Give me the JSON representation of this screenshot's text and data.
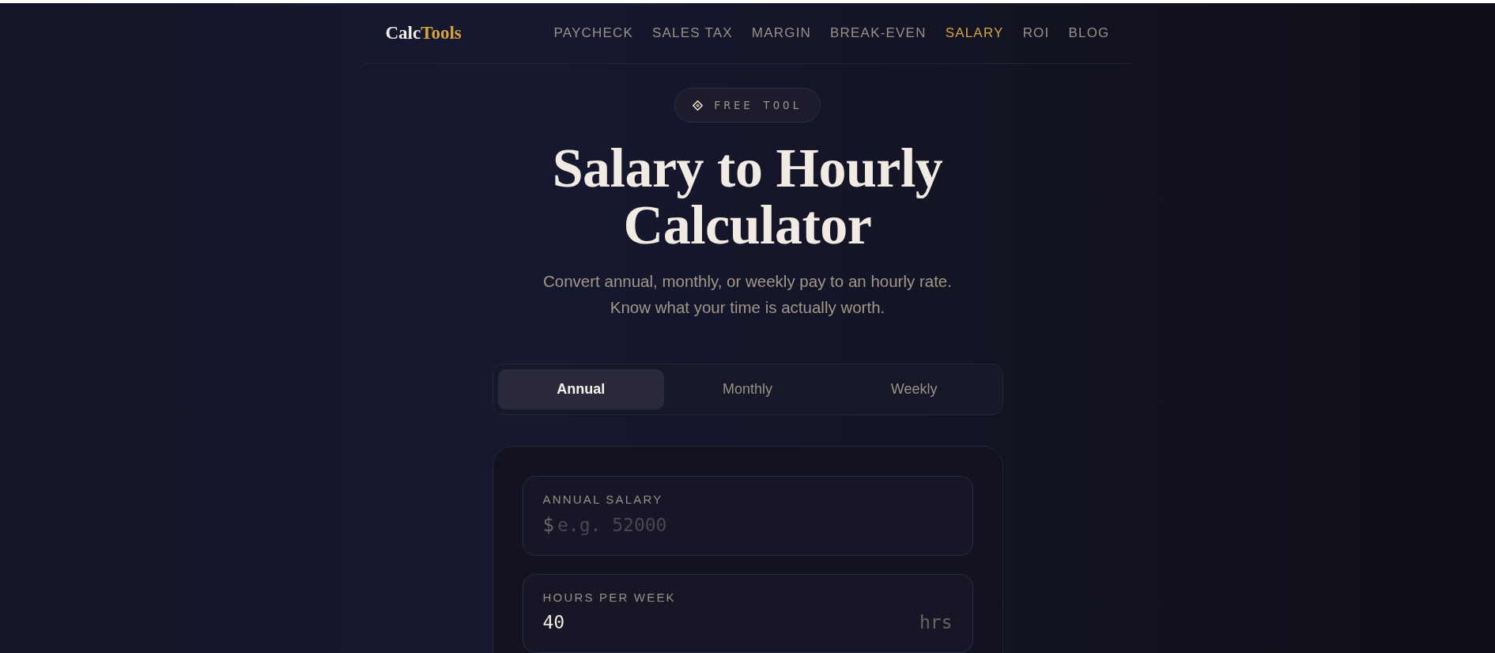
{
  "header": {
    "logo": {
      "first": "Calc",
      "second": "Tools"
    },
    "nav": [
      {
        "label": "PAYCHECK",
        "selected": false
      },
      {
        "label": "SALES TAX",
        "selected": false
      },
      {
        "label": "MARGIN",
        "selected": false
      },
      {
        "label": "BREAK-EVEN",
        "selected": false
      },
      {
        "label": "SALARY",
        "selected": true
      },
      {
        "label": "ROI",
        "selected": false
      },
      {
        "label": "BLOG",
        "selected": false
      }
    ]
  },
  "badge": "FREE TOOL",
  "title": "Salary to Hourly Calculator",
  "subtitle": [
    "Convert annual, monthly, or weekly pay to an hourly rate.",
    "Know what your time is actually worth."
  ],
  "tabs": [
    {
      "label": "Annual",
      "selected": true
    },
    {
      "label": "Monthly",
      "selected": false
    },
    {
      "label": "Weekly",
      "selected": false
    }
  ],
  "fields": [
    {
      "label": "ANNUAL SALARY",
      "prefix": "$",
      "placeholder": "e.g. 52000"
    },
    {
      "label": "HOURS PER WEEK",
      "value": "40",
      "suffix": "hrs"
    }
  ]
}
